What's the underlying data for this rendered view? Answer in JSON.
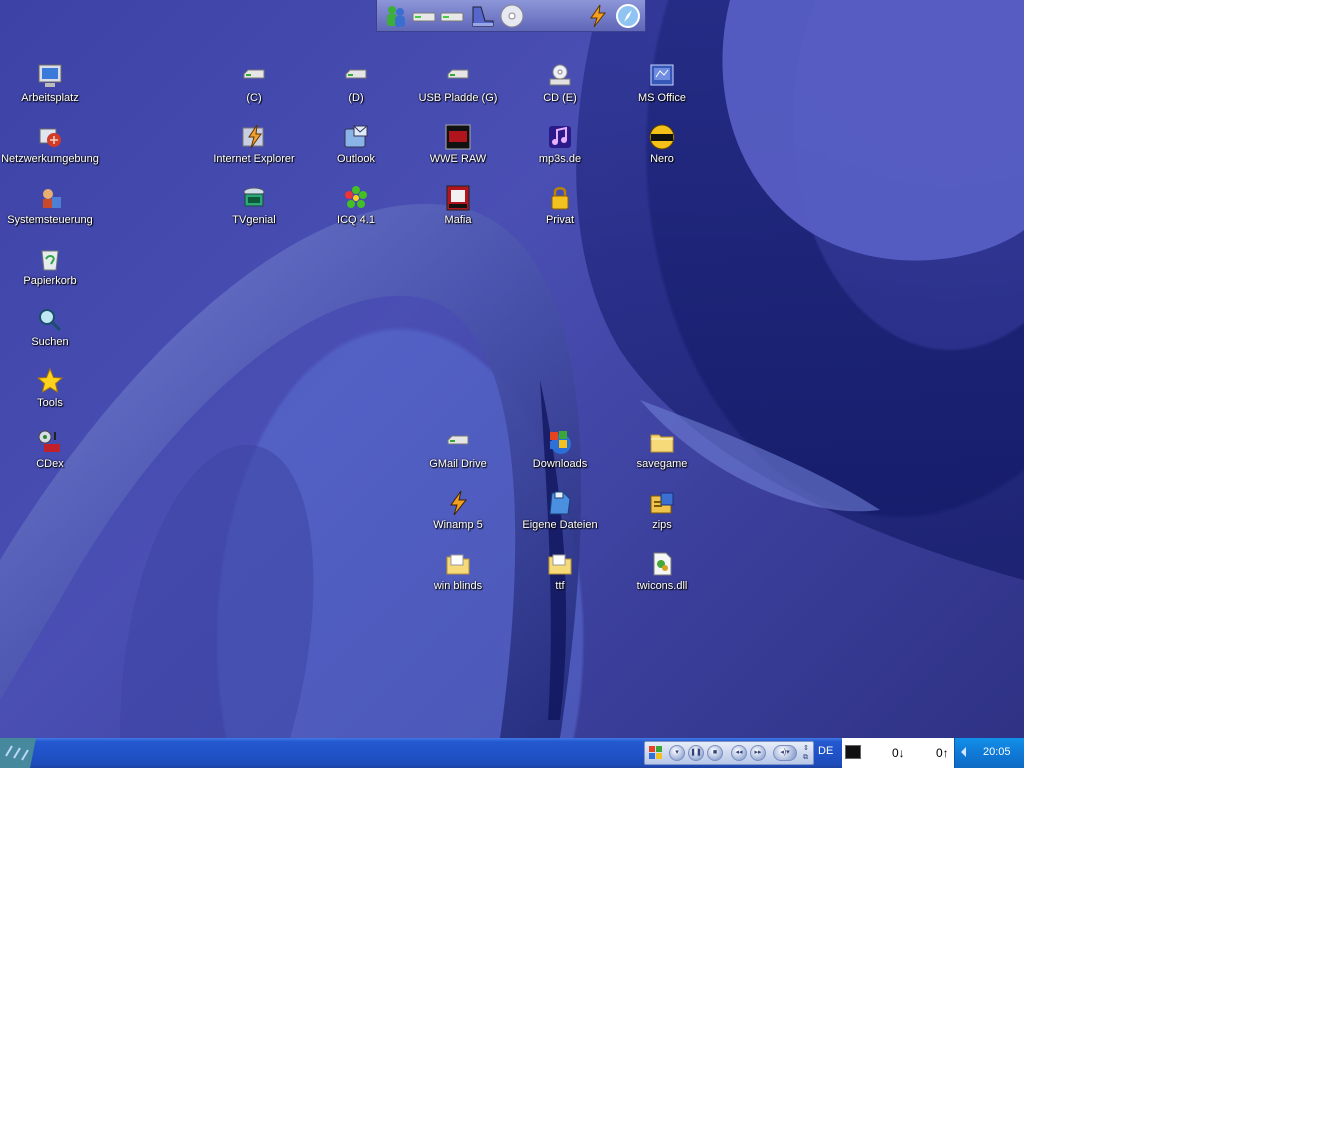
{
  "quick_launch": {
    "icons": [
      "msn-messenger-icon",
      "drive-icon",
      "drive-icon",
      "scanner-icon",
      "cd-icon",
      "winamp-icon",
      "compass-icon"
    ]
  },
  "desktop": {
    "icons": [
      {
        "label": "Arbeitsplatz",
        "icon": "my-computer-icon"
      },
      {
        "label": "Netzwerkumgebung",
        "icon": "network-icon"
      },
      {
        "label": "Systemsteuerung",
        "icon": "control-panel-icon"
      },
      {
        "label": "Papierkorb",
        "icon": "recycle-bin-icon"
      },
      {
        "label": "Suchen",
        "icon": "search-icon"
      },
      {
        "label": "Tools",
        "icon": "star-icon"
      },
      {
        "label": "CDex",
        "icon": "cdex-icon"
      },
      {
        "label": "(C)",
        "icon": "drive-icon"
      },
      {
        "label": "(D)",
        "icon": "drive-icon"
      },
      {
        "label": "USB Pladde (G)",
        "icon": "drive-icon"
      },
      {
        "label": "CD (E)",
        "icon": "cd-drive-icon"
      },
      {
        "label": "MS Office",
        "icon": "office-icon"
      },
      {
        "label": "Internet Explorer",
        "icon": "ie-icon"
      },
      {
        "label": "Outlook",
        "icon": "outlook-icon"
      },
      {
        "label": "WWE RAW",
        "icon": "raw-icon"
      },
      {
        "label": "mp3s.de",
        "icon": "music-icon"
      },
      {
        "label": "Nero",
        "icon": "nero-icon"
      },
      {
        "label": "TVgenial",
        "icon": "tv-icon"
      },
      {
        "label": "ICQ 4.1",
        "icon": "icq-flower-icon"
      },
      {
        "label": "Mafia",
        "icon": "mafia-icon"
      },
      {
        "label": "Privat",
        "icon": "lock-icon"
      },
      {
        "label": "GMail Drive",
        "icon": "drive-icon"
      },
      {
        "label": "Downloads",
        "icon": "windows-logo-icon"
      },
      {
        "label": "savegame",
        "icon": "folder-icon"
      },
      {
        "label": "Winamp 5",
        "icon": "winamp-icon"
      },
      {
        "label": "Eigene Dateien",
        "icon": "documents-icon"
      },
      {
        "label": "zips",
        "icon": "archive-icon"
      },
      {
        "label": "win blinds",
        "icon": "folder-icon"
      },
      {
        "label": "ttf",
        "icon": "folder-icon"
      },
      {
        "label": "twicons.dll",
        "icon": "dll-file-icon"
      }
    ]
  },
  "taskbar": {
    "language": "DE",
    "net_down": "0↓",
    "net_up": "0↑",
    "clock": "20:05"
  },
  "colors": {
    "taskbar": "#2052c9",
    "tray": "#0f7ad6",
    "desktop": "#4a4fb4"
  }
}
